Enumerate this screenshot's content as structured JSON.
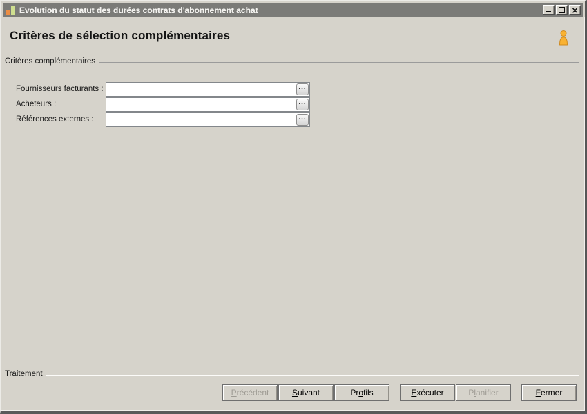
{
  "window": {
    "title": "Evolution du statut des durées contrats d'abonnement achat",
    "close_glyph": "×"
  },
  "header": {
    "title": "Critères de sélection complémentaires"
  },
  "criteria": {
    "legend": "Critères complémentaires",
    "browse_label": "...",
    "fields": [
      {
        "label": "Fournisseurs facturants :",
        "value": ""
      },
      {
        "label": "Acheteurs :",
        "value": ""
      },
      {
        "label": "Références externes :",
        "value": ""
      }
    ]
  },
  "footer": {
    "legend": "Traitement",
    "buttons": [
      {
        "id": "precedent",
        "pre": "",
        "accel": "P",
        "post": "récédent",
        "enabled": false
      },
      {
        "id": "suivant",
        "pre": "",
        "accel": "S",
        "post": "uivant",
        "enabled": true
      },
      {
        "id": "profils",
        "pre": "Pr",
        "accel": "o",
        "post": "fils",
        "enabled": true
      },
      {
        "id": "executer",
        "pre": "",
        "accel": "E",
        "post": "xécuter",
        "enabled": true
      },
      {
        "id": "planifier",
        "pre": "P",
        "accel": "l",
        "post": "anifier",
        "enabled": false
      },
      {
        "id": "fermer",
        "pre": "",
        "accel": "F",
        "post": "ermer",
        "enabled": true
      }
    ]
  },
  "colors": {
    "titlebar": "#7b7b78",
    "background": "#d6d3cb",
    "logo_orange": "#ec8d44",
    "logo_green": "#cfdf90",
    "person_icon_fill": "#f9b233",
    "person_icon_stroke": "#d08a1d",
    "disabled_text": "#9e9b94"
  }
}
